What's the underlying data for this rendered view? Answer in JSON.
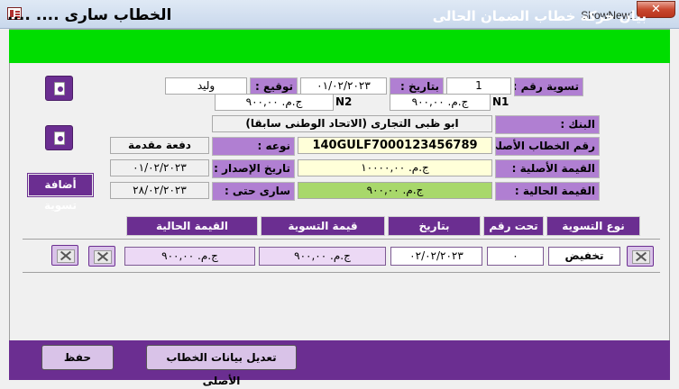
{
  "window": {
    "title": "ShowNew1",
    "close_glyph": "✕"
  },
  "header": {
    "title": "بيان حركة خطاب الضمان الحالى",
    "status": "الخطاب سارى .... ....",
    "bg_color": "#00dd00"
  },
  "settlement": {
    "number_label": "تسوية رقم :",
    "number_value": "1",
    "date_label": "بتاريخ :",
    "date_value": "٠١/٠٢/٢٠٢٣",
    "signature_label": "توقيع :",
    "signature_value": "وليد",
    "n1_label": "N1",
    "n1_value": "ج.م. ٩٠٠,٠٠",
    "n2_label": "N2",
    "n2_value": "ج.م. ٩٠٠,٠٠"
  },
  "form": {
    "bank_label": "البنك :",
    "bank_value": "ابو ظبى التجارى (الاتحاد الوطنى سابقا)",
    "ref_label": "رقم الخطاب الأصلى :",
    "ref_value": "140GULF7000123456789",
    "type_label": "نوعه :",
    "type_value": "دفعة مقدمة",
    "orig_value_label": "القيمة الأصلية :",
    "orig_value": "ج.م. ١٠٠٠٠,٠٠",
    "issue_date_label": "تاريخ الإصدار :",
    "issue_date_value": "٠١/٠٢/٢٠٢٣",
    "current_value_label": "القيمة الحالية :",
    "current_value": "ج.م. ٩٠٠,٠٠",
    "valid_until_label": "سارى حتى :",
    "valid_until_value": "٢٨/٠٢/٢٠٢٣",
    "add_settlement_label": "أضافة تسوية"
  },
  "table": {
    "headers": [
      "نوع التسوية",
      "تحت رقم",
      "بتاريخ",
      "قيمة التسوية",
      "القيمة الحالية"
    ],
    "row": {
      "type": "تخفيض",
      "number": "٠",
      "date": "٠٢/٠٢/٢٠٢٣",
      "settlement_value": "ج.م. ٩٠٠,٠٠",
      "current_value": "ج.م. ٩٠٠,٠٠"
    }
  },
  "footer": {
    "save_label": "حفظ",
    "edit_label": "تعديل بيانات الخطاب الأصلى"
  },
  "colors": {
    "purple": "#6b2e91",
    "light_purple": "#b07fd2",
    "green_field": "#a8d86b",
    "yellow_field": "#ffffd9"
  },
  "icons": [
    "app-icon",
    "document-icon",
    "delete-icon"
  ]
}
